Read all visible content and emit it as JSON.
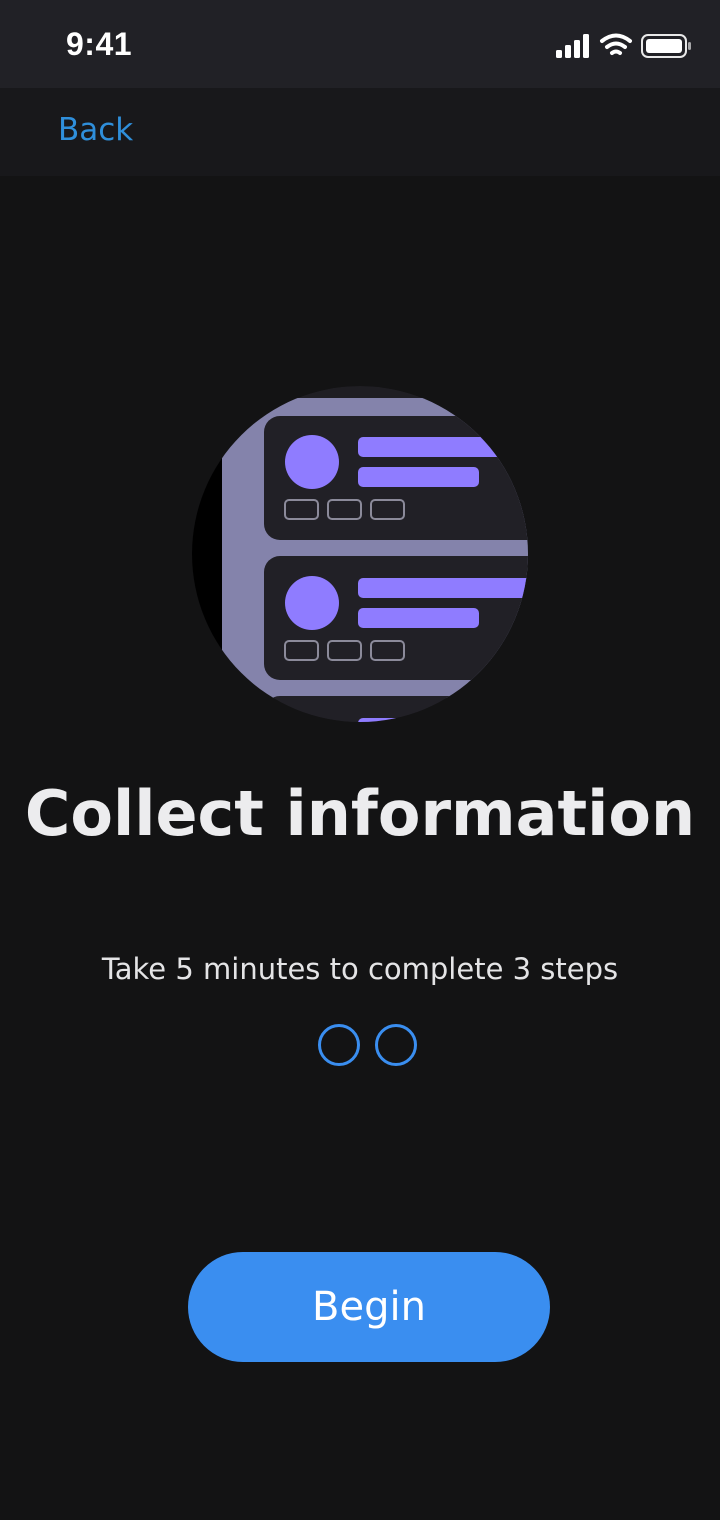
{
  "status_bar": {
    "time": "9:41",
    "icons": [
      "signal-icon",
      "wifi-icon",
      "battery-icon"
    ]
  },
  "nav": {
    "back_label": "Back"
  },
  "illustration": {
    "name": "list-cards-illustration",
    "colors": {
      "circle_bg": "#1f1e23",
      "frame": "#8483ab",
      "card": "#212026",
      "accent": "#8f7cff",
      "tag_outline": "#8b8a9a"
    }
  },
  "content": {
    "title": "Collect information",
    "subtitle": "Take 5 minutes to complete 3 steps",
    "step_indicator_count": 2
  },
  "cta": {
    "begin_label": "Begin"
  },
  "colors": {
    "background": "#131314",
    "status_bar": "#212126",
    "nav_bar": "#18181b",
    "accent": "#3a8ef0",
    "link": "#2f8fdb"
  }
}
